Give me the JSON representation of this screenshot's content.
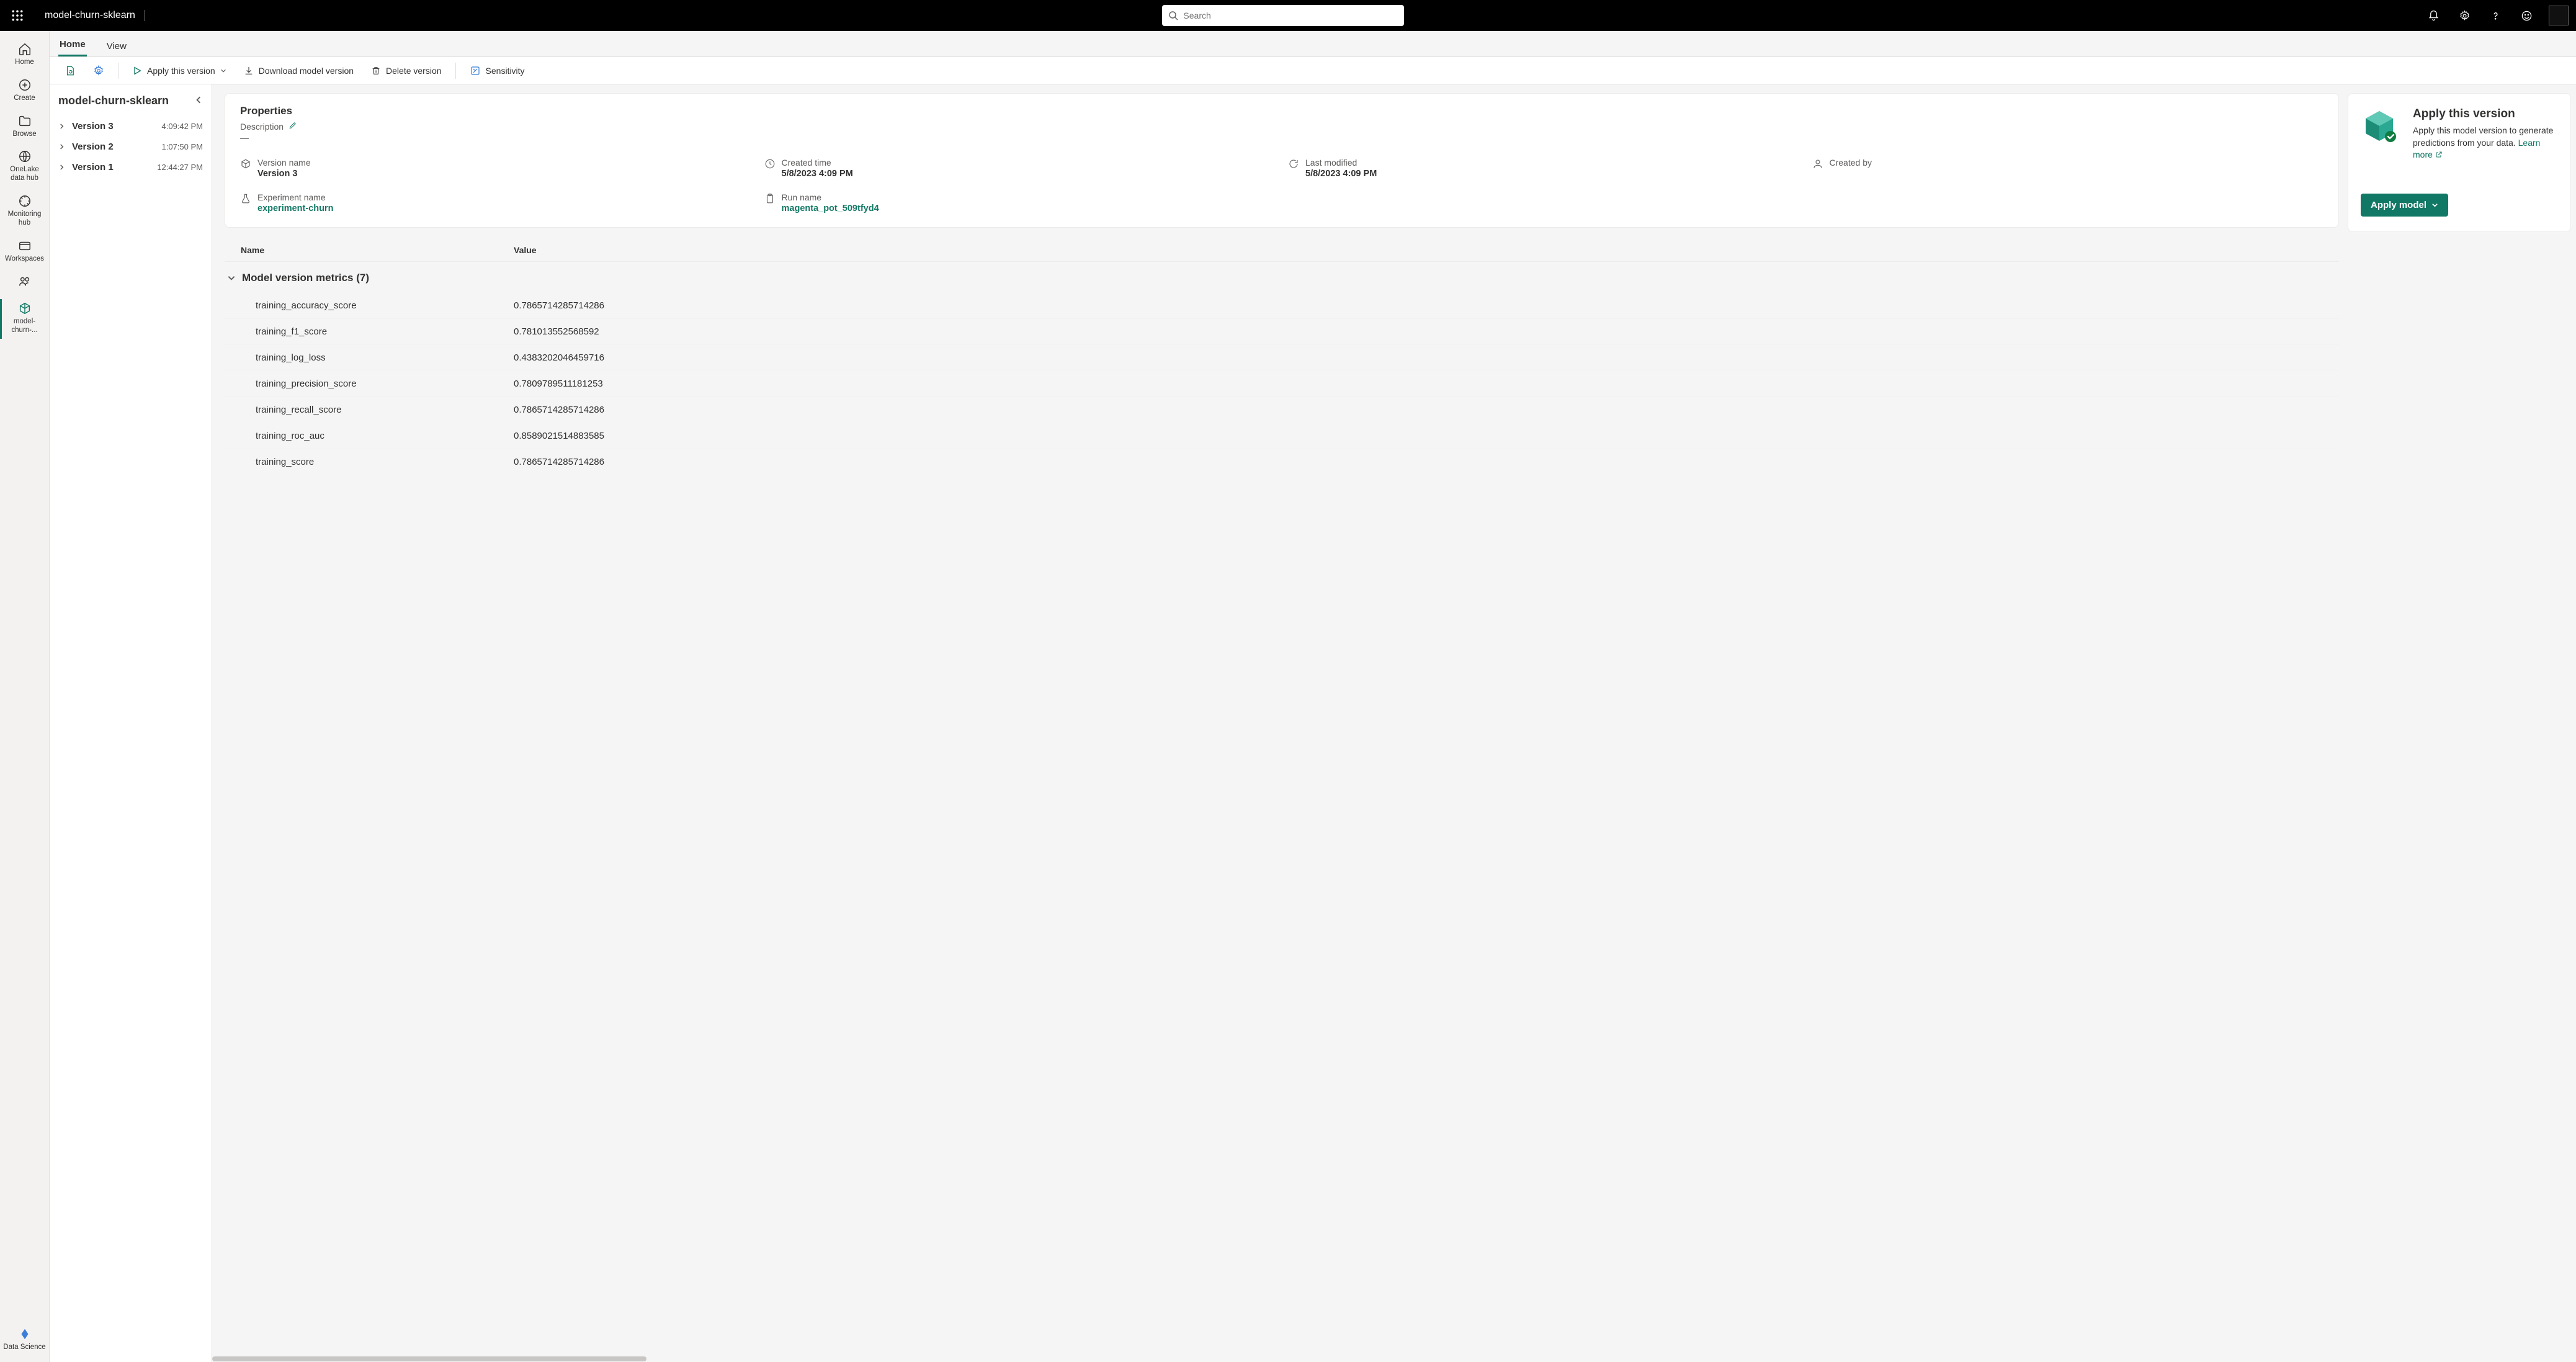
{
  "topbar": {
    "title": "model-churn-sklearn",
    "search_placeholder": "Search"
  },
  "nav_rail": [
    {
      "label": "Home"
    },
    {
      "label": "Create"
    },
    {
      "label": "Browse"
    },
    {
      "label": "OneLake data hub"
    },
    {
      "label": "Monitoring hub"
    },
    {
      "label": "Workspaces"
    }
  ],
  "nav_rail_active": {
    "label": "model-churn-..."
  },
  "nav_rail_bottom": {
    "label": "Data Science"
  },
  "tabs": {
    "home": "Home",
    "view": "View"
  },
  "toolbar": {
    "apply_version": "Apply this version",
    "download": "Download model version",
    "delete": "Delete version",
    "sensitivity": "Sensitivity"
  },
  "version_panel": {
    "title": "model-churn-sklearn",
    "items": [
      {
        "name": "Version 3",
        "time": "4:09:42 PM"
      },
      {
        "name": "Version 2",
        "time": "1:07:50 PM"
      },
      {
        "name": "Version 1",
        "time": "12:44:27 PM"
      }
    ]
  },
  "properties": {
    "title": "Properties",
    "description_label": "Description",
    "description_value": "—",
    "version_name_label": "Version name",
    "version_name_value": "Version 3",
    "created_time_label": "Created time",
    "created_time_value": "5/8/2023 4:09 PM",
    "last_modified_label": "Last modified",
    "last_modified_value": "5/8/2023 4:09 PM",
    "created_by_label": "Created by",
    "created_by_value": "",
    "experiment_name_label": "Experiment name",
    "experiment_name_value": "experiment-churn",
    "run_name_label": "Run name",
    "run_name_value": "magenta_pot_509tfyd4"
  },
  "metrics": {
    "col_name": "Name",
    "col_value": "Value",
    "group_title": "Model version metrics (7)",
    "rows": [
      {
        "name": "training_accuracy_score",
        "value": "0.7865714285714286"
      },
      {
        "name": "training_f1_score",
        "value": "0.781013552568592"
      },
      {
        "name": "training_log_loss",
        "value": "0.4383202046459716"
      },
      {
        "name": "training_precision_score",
        "value": "0.7809789511181253"
      },
      {
        "name": "training_recall_score",
        "value": "0.7865714285714286"
      },
      {
        "name": "training_roc_auc",
        "value": "0.8589021514883585"
      },
      {
        "name": "training_score",
        "value": "0.7865714285714286"
      }
    ]
  },
  "apply_card": {
    "title": "Apply this version",
    "desc": "Apply this model version to generate predictions from your data. ",
    "learn": "Learn more",
    "button": "Apply model"
  },
  "colors": {
    "accent": "#117865"
  }
}
